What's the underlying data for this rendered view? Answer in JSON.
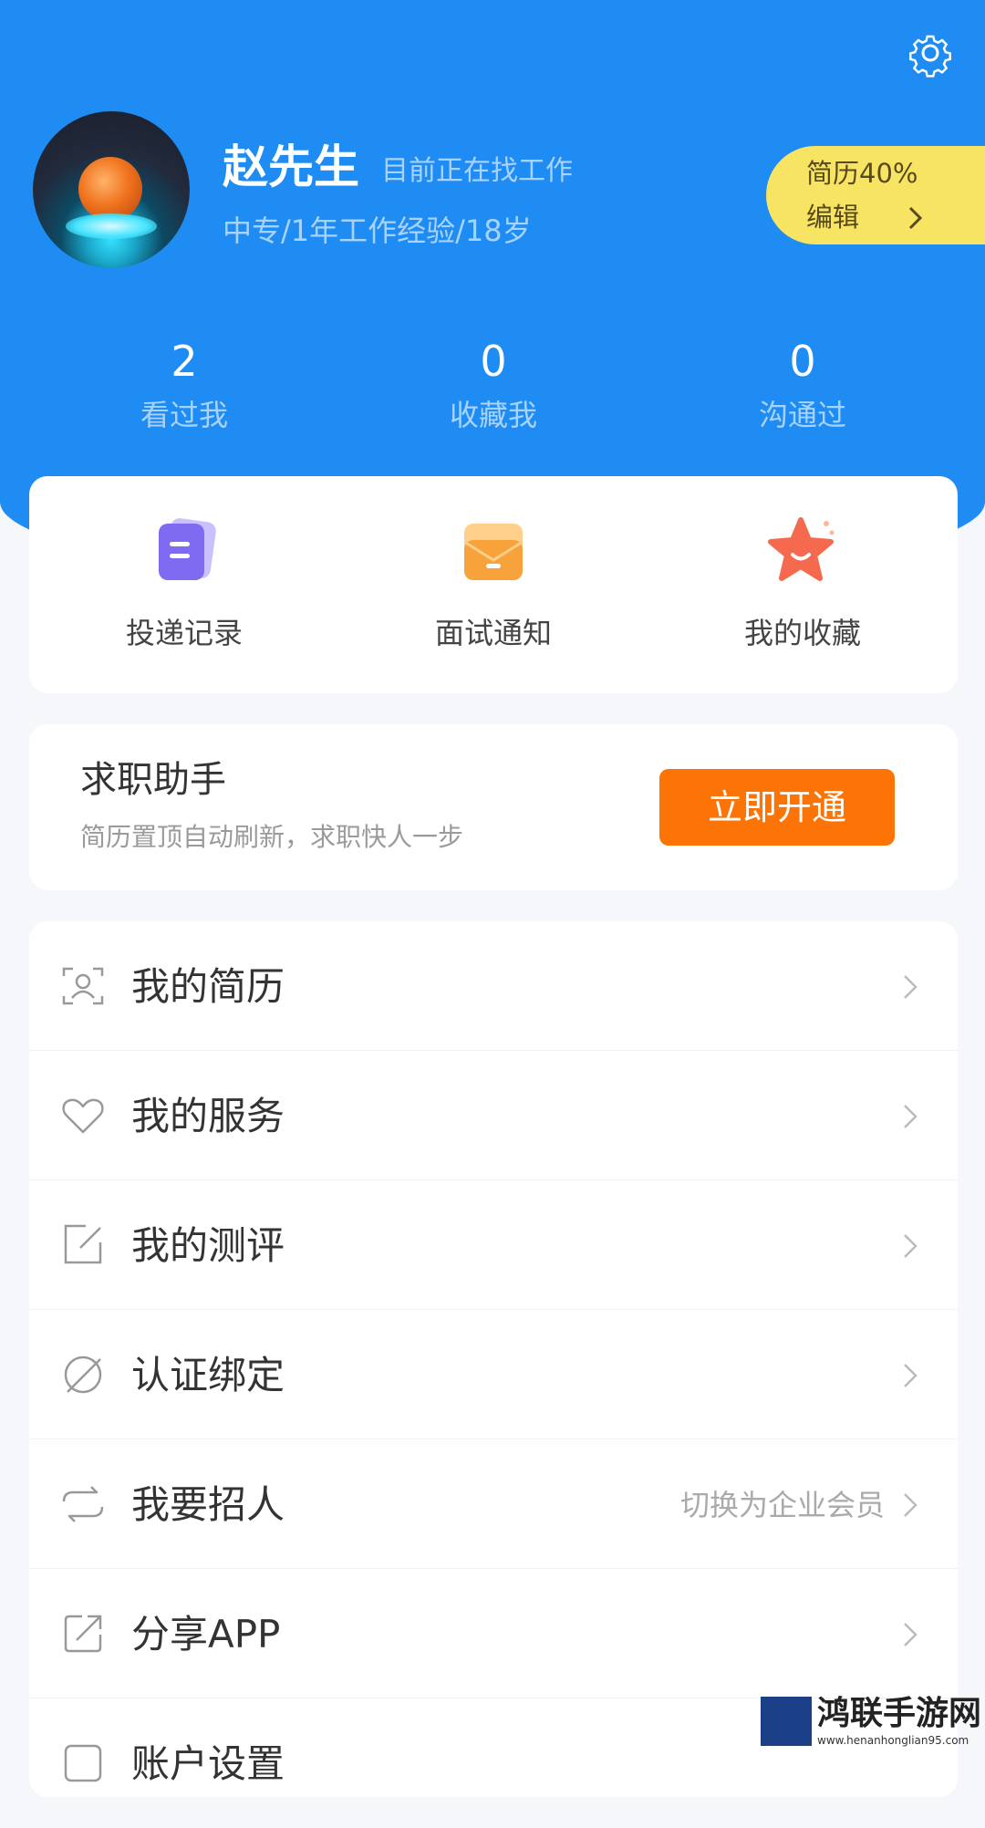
{
  "profile": {
    "name": "赵先生",
    "status": "目前正在找工作",
    "info": "中专/1年工作经验/18岁",
    "resume_percent": "简历40%",
    "resume_edit": "编辑"
  },
  "stats": [
    {
      "value": "2",
      "label": "看过我"
    },
    {
      "value": "0",
      "label": "收藏我"
    },
    {
      "value": "0",
      "label": "沟通过"
    }
  ],
  "quick_actions": [
    {
      "label": "投递记录",
      "icon": "document-icon"
    },
    {
      "label": "面试通知",
      "icon": "envelope-icon"
    },
    {
      "label": "我的收藏",
      "icon": "star-icon"
    }
  ],
  "assistant": {
    "title": "求职助手",
    "desc": "简历置顶自动刷新，求职快人一步",
    "button": "立即开通"
  },
  "menu": [
    {
      "label": "我的简历",
      "icon": "resume-icon",
      "value": ""
    },
    {
      "label": "我的服务",
      "icon": "heart-icon",
      "value": ""
    },
    {
      "label": "我的测评",
      "icon": "edit-icon",
      "value": ""
    },
    {
      "label": "认证绑定",
      "icon": "verify-icon",
      "value": ""
    },
    {
      "label": "我要招人",
      "icon": "switch-icon",
      "value": "切换为企业会员"
    },
    {
      "label": "分享APP",
      "icon": "share-icon",
      "value": ""
    },
    {
      "label": "账户设置",
      "icon": "account-settings-icon",
      "value": ""
    }
  ],
  "watermark": {
    "text": "鸿联手游网",
    "url": "www.henanhonglian95.com"
  },
  "colors": {
    "header_blue": "#1e8cf2",
    "accent_orange": "#fb7405",
    "resume_yellow": "#f7e463"
  }
}
